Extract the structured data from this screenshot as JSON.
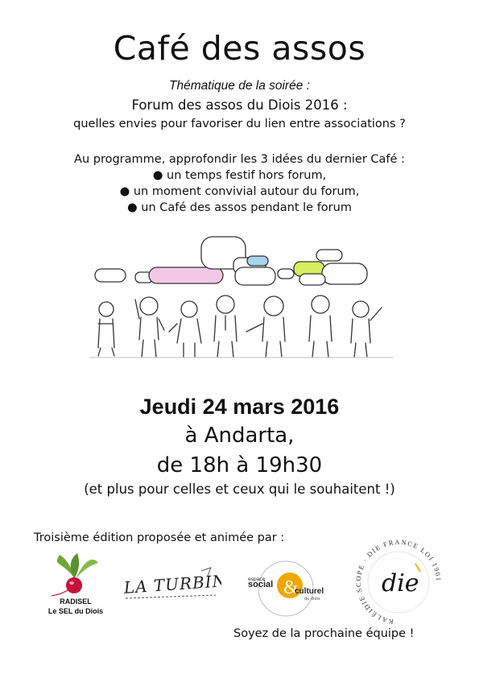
{
  "title": "Café des assos",
  "theme": {
    "label": "Thématique de la soirée :",
    "title": "Forum des assos du Diois 2016 :",
    "subtitle": "quelles envies pour favoriser du lien entre associations ?"
  },
  "programme": {
    "intro": "Au programme, approfondir les 3 idées du dernier Café :",
    "items": [
      "● un temps festif hors forum,",
      "● un moment convivial autour du forum,",
      "● un Café des assos pendant le forum"
    ]
  },
  "event": {
    "date": "Jeudi 24 mars 2016",
    "place": "à Andarta,",
    "time": "de 18h à 19h30",
    "extra": "(et plus pour celles et ceux qui le souhaitent !)"
  },
  "credit": "Troisième édition proposée et animée par :",
  "logos": {
    "radisel": {
      "name": "RADISEL",
      "caption": "Le SEL du Diois"
    },
    "turbine": {
      "text": "LA TURBINE"
    },
    "espace": {
      "small": "espace",
      "social": "social",
      "amp": "&",
      "culturel": "culturel",
      "region": "du diois"
    },
    "kalei": {
      "ring": "KALÉIDIE SCOPE · DIE FRANCE LOI 1901",
      "mark": "die"
    }
  },
  "footer_cta": "Soyez de la prochaine équipe !"
}
